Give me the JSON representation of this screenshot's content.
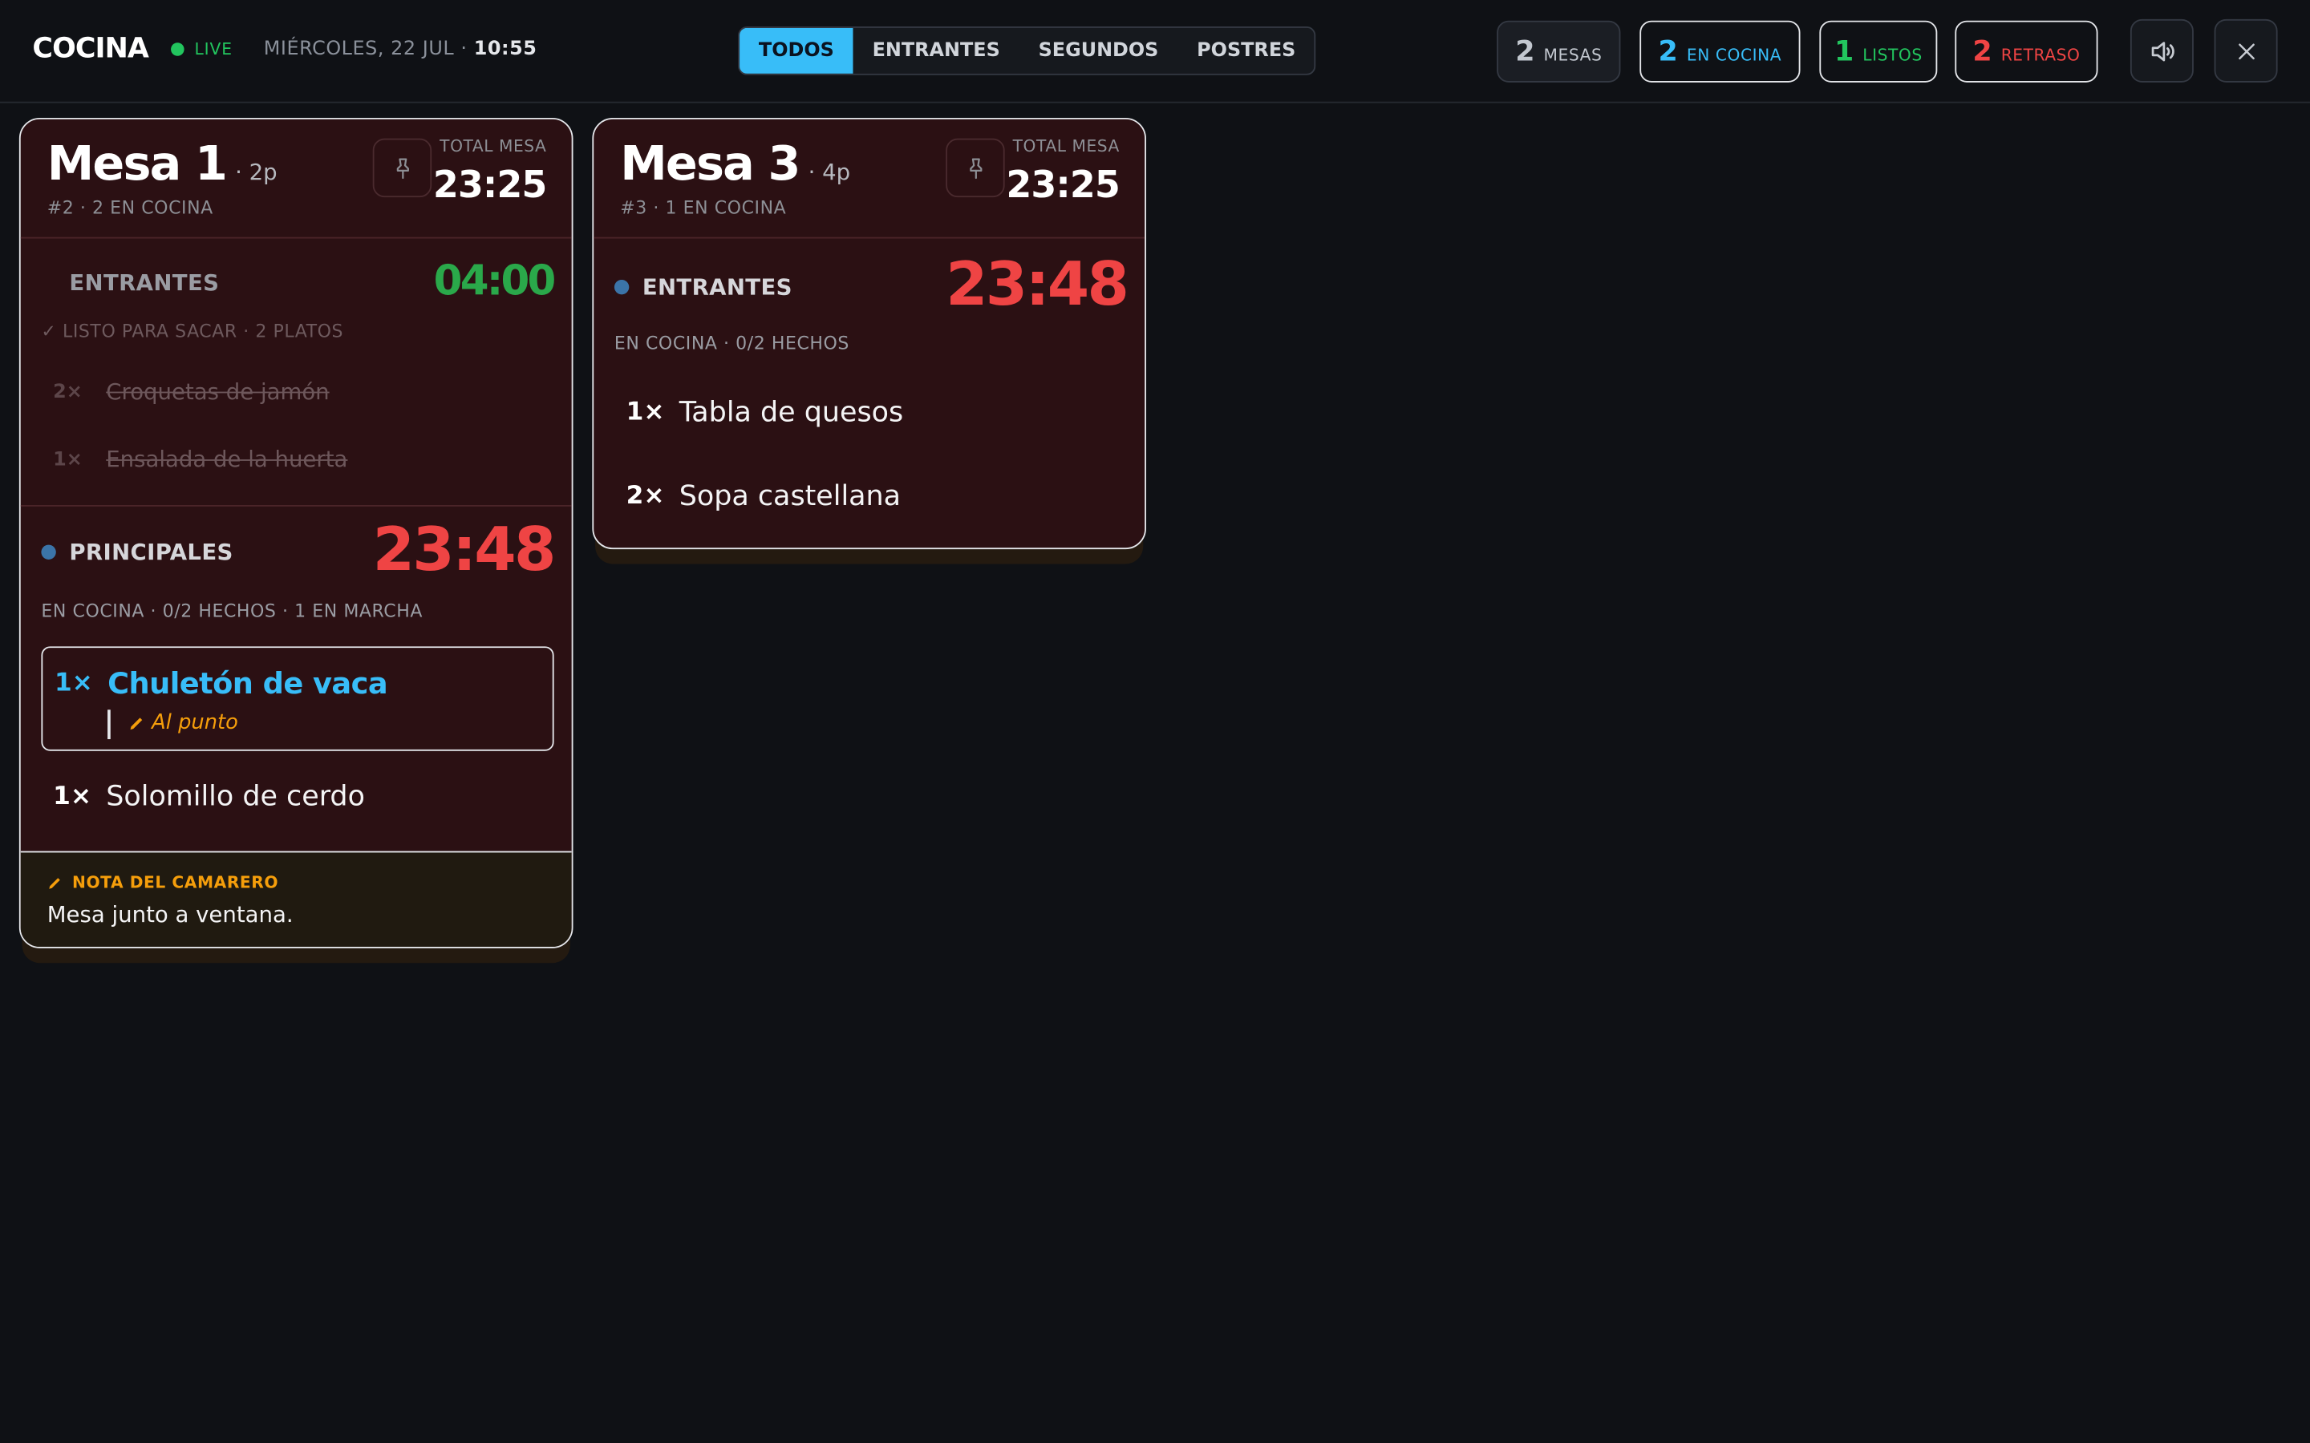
{
  "header": {
    "brand": "COCINA",
    "live": "LIVE",
    "date": "MIÉRCOLES, 22 JUL ·",
    "time": "10:55"
  },
  "tabs": [
    {
      "label": "TODOS",
      "active": true
    },
    {
      "label": "ENTRANTES",
      "active": false
    },
    {
      "label": "SEGUNDOS",
      "active": false
    },
    {
      "label": "POSTRES",
      "active": false
    }
  ],
  "stats": {
    "mesas": {
      "count": "2",
      "label": "MESAS"
    },
    "cocina": {
      "count": "2",
      "label": "EN COCINA"
    },
    "listos": {
      "count": "1",
      "label": "LISTOS"
    },
    "retraso": {
      "count": "2",
      "label": "RETRASO"
    }
  },
  "icons": {
    "sound": "speaker-icon",
    "close": "close-icon",
    "pin": "pin-icon",
    "note": "pencil-icon"
  },
  "colors": {
    "accent": "#38bdf8",
    "ready": "#22c55e",
    "late": "#ef4444",
    "note": "#f59e0b",
    "card_bg": "#2b1013"
  },
  "cards": [
    {
      "title": "Mesa 1",
      "pax": "· 2p",
      "subtitle": "#2 · 2 EN COCINA",
      "total_label": "TOTAL MESA",
      "total": "23:25",
      "sections": [
        {
          "name": "ENTRANTES",
          "timer": "04:00",
          "status": "✓ LISTO PARA SACAR · 2 PLATOS",
          "items": [
            {
              "qty": "2×",
              "name": "Croquetas de jamón",
              "done": true
            },
            {
              "qty": "1×",
              "name": "Ensalada de la huerta",
              "done": true
            }
          ]
        },
        {
          "name": "PRINCIPALES",
          "timer": "23:48",
          "status": "EN COCINA · 0/2 HECHOS · 1 EN MARCHA",
          "items": [
            {
              "qty": "1×",
              "name": "Chuletón de vaca",
              "modifier": "Al punto",
              "active": true
            },
            {
              "qty": "1×",
              "name": "Solomillo de cerdo"
            }
          ]
        }
      ],
      "note": {
        "label": "NOTA DEL CAMARERO",
        "text": "Mesa junto a ventana."
      }
    },
    {
      "title": "Mesa 3",
      "pax": "· 4p",
      "subtitle": "#3 · 1 EN COCINA",
      "total_label": "TOTAL MESA",
      "total": "23:25",
      "sections": [
        {
          "name": "ENTRANTES",
          "timer": "23:48",
          "status": "EN COCINA · 0/2 HECHOS",
          "items": [
            {
              "qty": "1×",
              "name": "Tabla de quesos"
            },
            {
              "qty": "2×",
              "name": "Sopa castellana"
            }
          ]
        }
      ]
    }
  ]
}
